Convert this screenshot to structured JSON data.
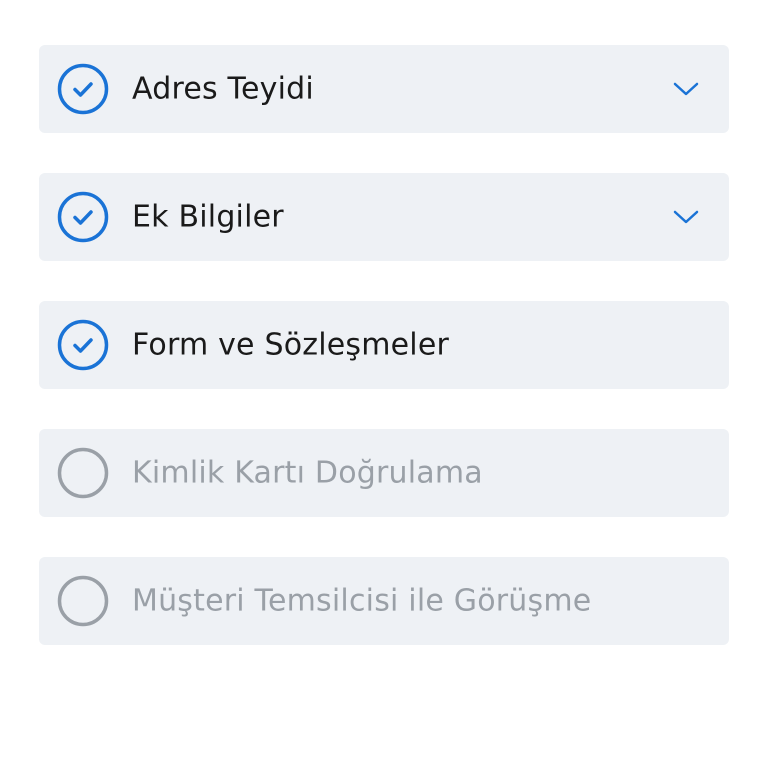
{
  "colors": {
    "accent": "#1a73d6",
    "pending": "#9aa0a7",
    "card_background": "#eef1f5",
    "text_primary": "#1a1a1a"
  },
  "steps": [
    {
      "label": "Adres Teyidi",
      "status": "completed",
      "icon": "check-circle-icon",
      "expandable": true,
      "chevron": "chevron-down-icon"
    },
    {
      "label": "Ek Bilgiler",
      "status": "completed",
      "icon": "check-circle-icon",
      "expandable": true,
      "chevron": "chevron-down-icon"
    },
    {
      "label": "Form ve Sözleşmeler",
      "status": "completed",
      "icon": "check-circle-icon",
      "expandable": false
    },
    {
      "label": "Kimlik Kartı Doğrulama",
      "status": "pending",
      "icon": "empty-circle-icon",
      "expandable": false
    },
    {
      "label": "Müşteri Temsilcisi ile Görüşme",
      "status": "pending",
      "icon": "empty-circle-icon",
      "expandable": false
    }
  ]
}
